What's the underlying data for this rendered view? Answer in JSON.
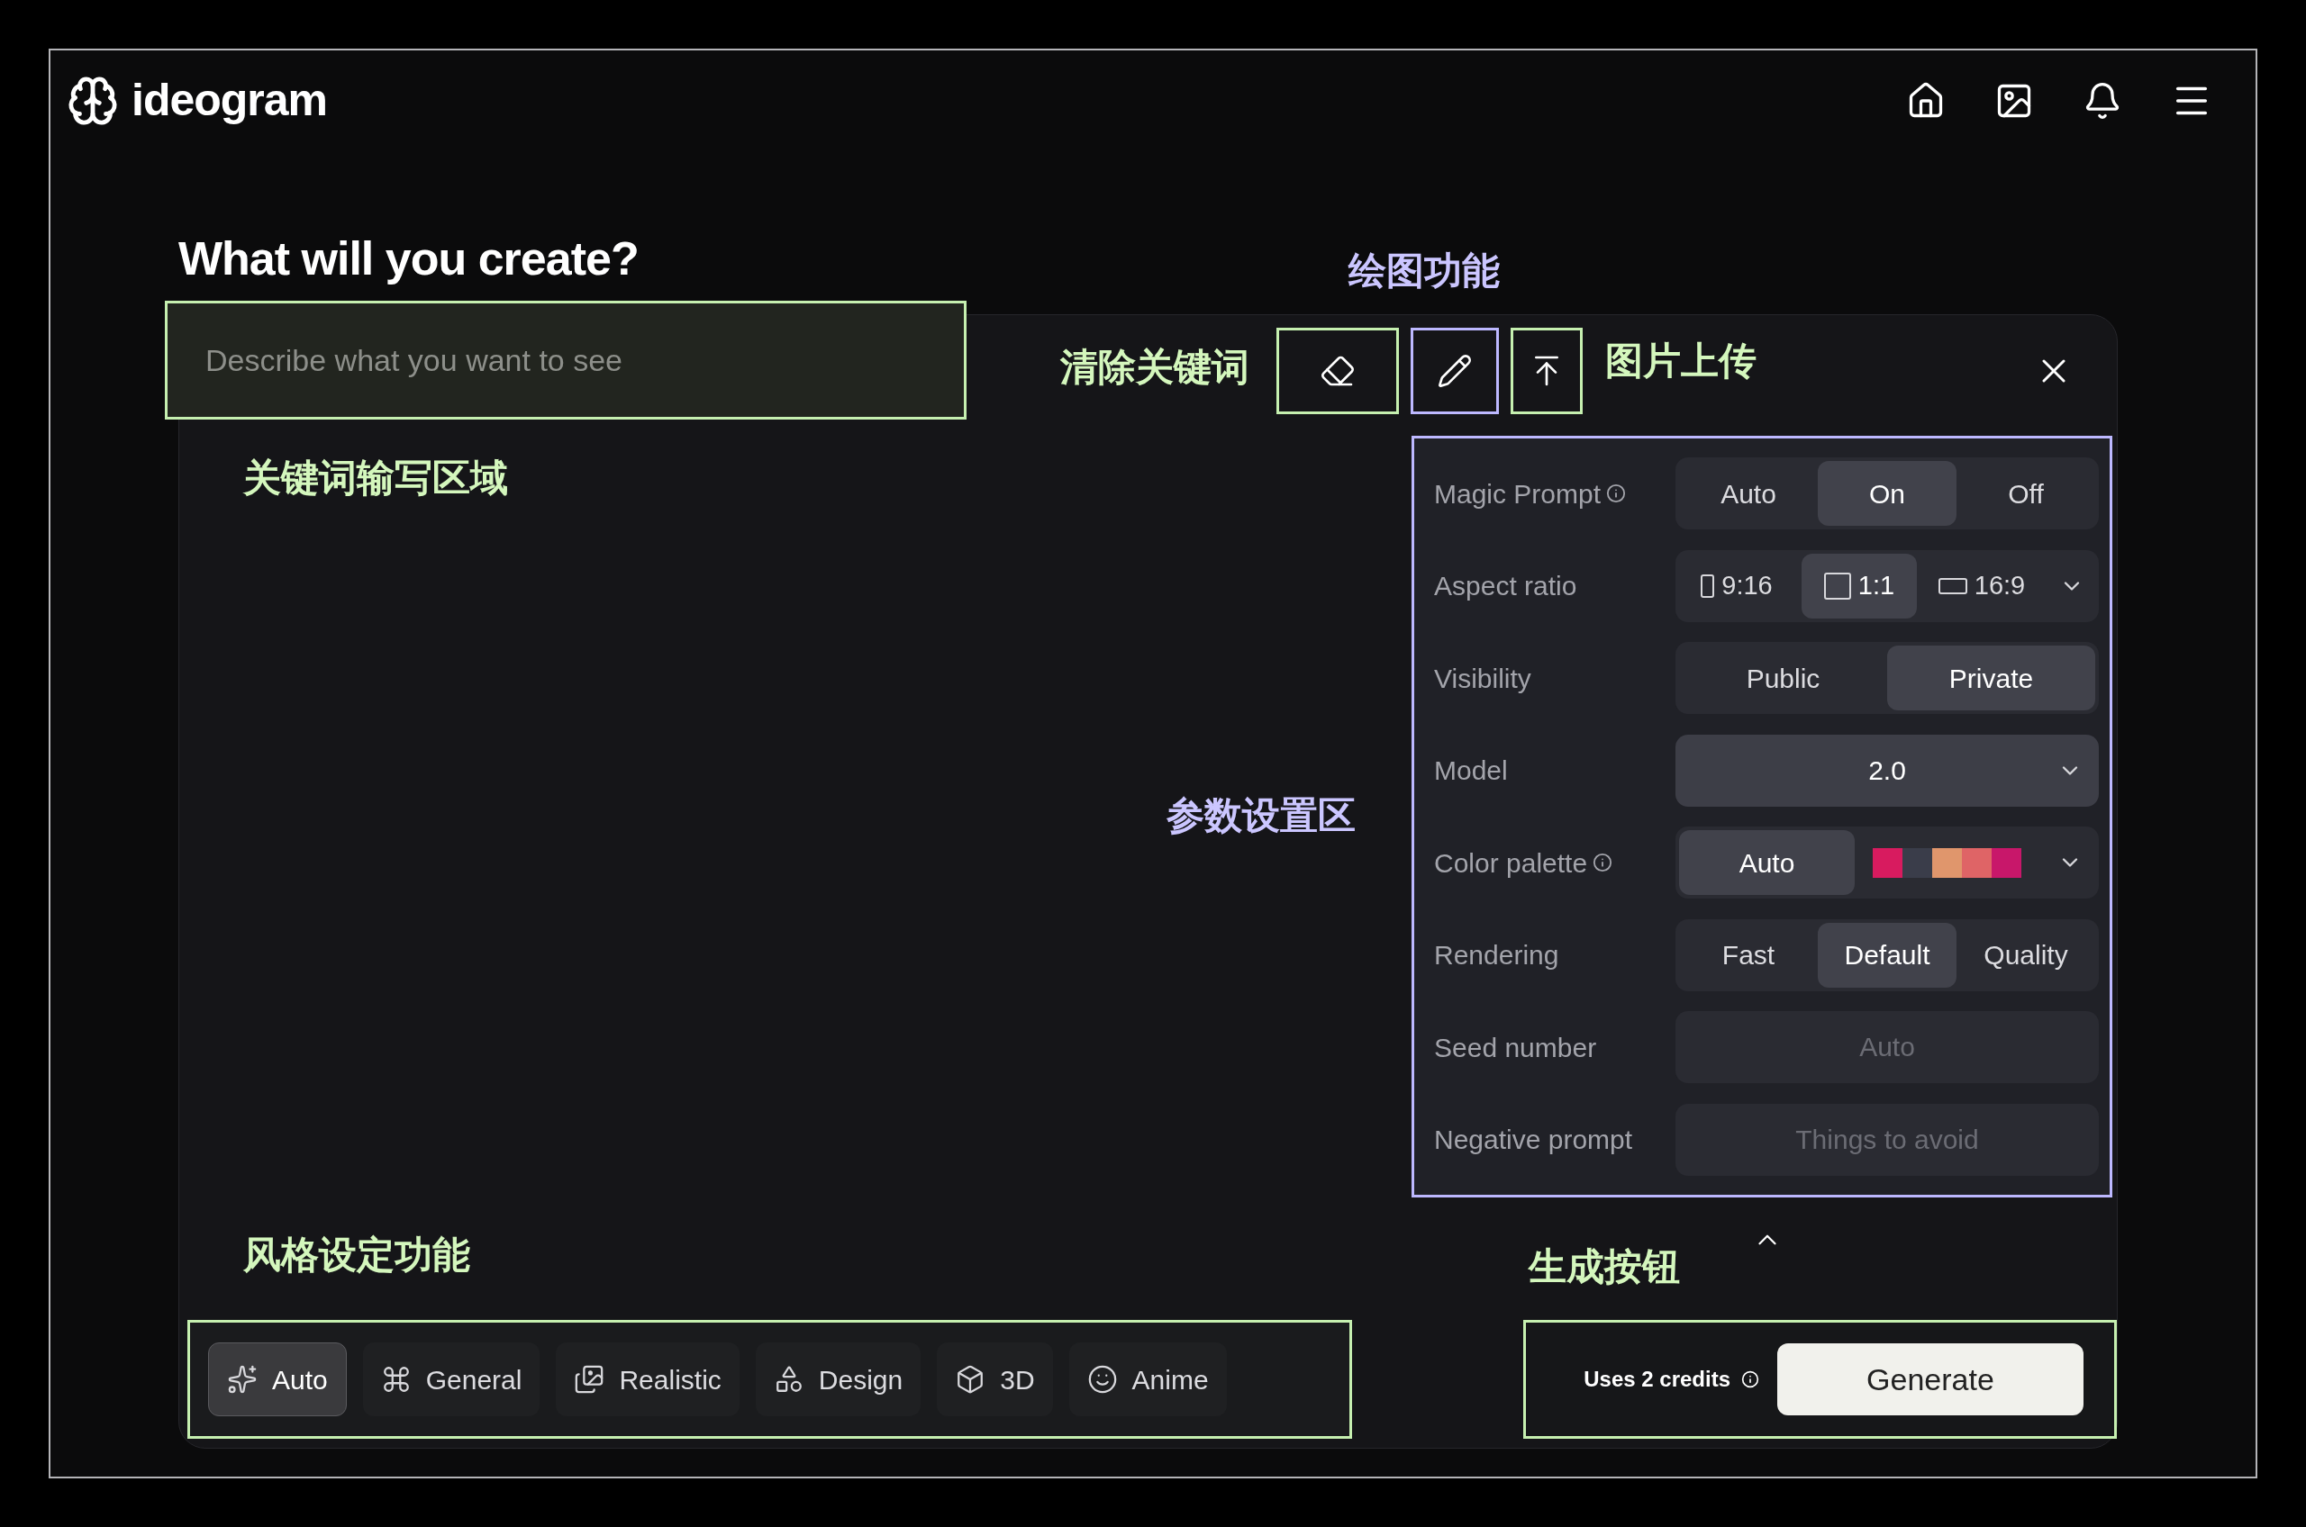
{
  "header": {
    "logo": "ideogram"
  },
  "heading": "What will you create?",
  "prompt": {
    "placeholder": "Describe what you want to see"
  },
  "annotations": [
    {
      "text": "绘图功能",
      "color": "#cbc6ff"
    },
    {
      "text": "清除关键词",
      "color": "#d4f7bd"
    },
    {
      "text": "图片上传",
      "color": "#d4f7bd"
    },
    {
      "text": "关键词输写区域",
      "color": "#d4f7bd"
    },
    {
      "text": "参数设置区",
      "color": "#cbc6ff"
    },
    {
      "text": "风格设定功能",
      "color": "#d4f7bd"
    },
    {
      "text": "生成按钮",
      "color": "#d4f7bd"
    }
  ],
  "settings": [
    {
      "label": "Magic Prompt",
      "info": true,
      "kind": "segmented",
      "options": [
        {
          "label": "Auto",
          "selected": false
        },
        {
          "label": "On",
          "selected": true
        },
        {
          "label": "Off",
          "selected": false
        }
      ]
    },
    {
      "label": "Aspect ratio",
      "info": false,
      "kind": "aspect",
      "options": [
        {
          "label": "9:16",
          "kind": "portrait",
          "selected": false
        },
        {
          "label": "1:1",
          "kind": "square",
          "selected": true
        },
        {
          "label": "16:9",
          "kind": "landscape",
          "selected": false
        }
      ]
    },
    {
      "label": "Visibility",
      "info": false,
      "kind": "segmented",
      "options": [
        {
          "label": "Public",
          "selected": false
        },
        {
          "label": "Private",
          "selected": true
        }
      ]
    },
    {
      "label": "Model",
      "info": false,
      "kind": "select",
      "value": "2.0"
    },
    {
      "label": "Color palette",
      "info": true,
      "kind": "palette",
      "auto": {
        "label": "Auto",
        "selected": true
      },
      "swatches": [
        {
          "color": "#d81b5f"
        },
        {
          "color": "#3a3d4a"
        },
        {
          "color": "#e0966c"
        },
        {
          "color": "#df6466"
        },
        {
          "color": "#c8176a"
        }
      ]
    },
    {
      "label": "Rendering",
      "info": false,
      "kind": "segmented",
      "options": [
        {
          "label": "Fast",
          "selected": false
        },
        {
          "label": "Default",
          "selected": true
        },
        {
          "label": "Quality",
          "selected": false
        }
      ]
    },
    {
      "label": "Seed number",
      "info": false,
      "kind": "input",
      "placeholder": "Auto"
    },
    {
      "label": "Negative prompt",
      "info": false,
      "kind": "input",
      "placeholder": "Things to avoid"
    }
  ],
  "styles": [
    {
      "label": "Auto",
      "kind": "sparkles",
      "selected": true
    },
    {
      "label": "General",
      "kind": "command",
      "selected": false
    },
    {
      "label": "Realistic",
      "kind": "photos",
      "selected": false
    },
    {
      "label": "Design",
      "kind": "shapes",
      "selected": false
    },
    {
      "label": "3D",
      "kind": "cube",
      "selected": false
    },
    {
      "label": "Anime",
      "kind": "face",
      "selected": false
    }
  ],
  "generate": {
    "credits": "Uses 2 credits",
    "button": "Generate"
  }
}
